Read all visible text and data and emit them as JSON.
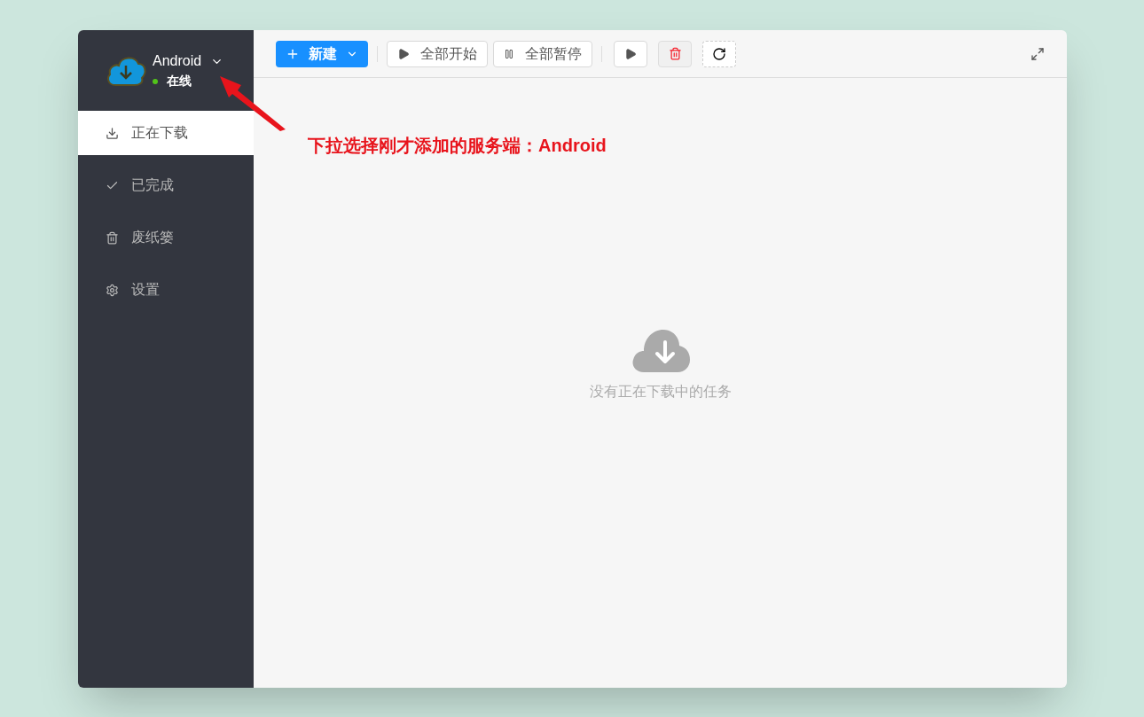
{
  "server": {
    "name": "Android",
    "status": "在线",
    "online": true
  },
  "nav": [
    {
      "label": "正在下载",
      "selected": true
    },
    {
      "label": "已完成",
      "selected": false
    },
    {
      "label": "废纸篓",
      "selected": false
    },
    {
      "label": "设置",
      "selected": false
    }
  ],
  "toolbar": [
    {
      "kind": "primary",
      "label": "新建"
    },
    {
      "kind": "divider"
    },
    {
      "kind": "start",
      "label": "全部开始"
    },
    {
      "kind": "pause",
      "label": "全部暂停"
    },
    {
      "kind": "divider"
    },
    {
      "kind": "play"
    },
    {
      "kind": "delete"
    },
    {
      "kind": "refresh"
    }
  ],
  "empty": {
    "message": "没有正在下载中的任务"
  },
  "annotation": {
    "text": "下拉选择刚才添加的服务端：Android"
  }
}
